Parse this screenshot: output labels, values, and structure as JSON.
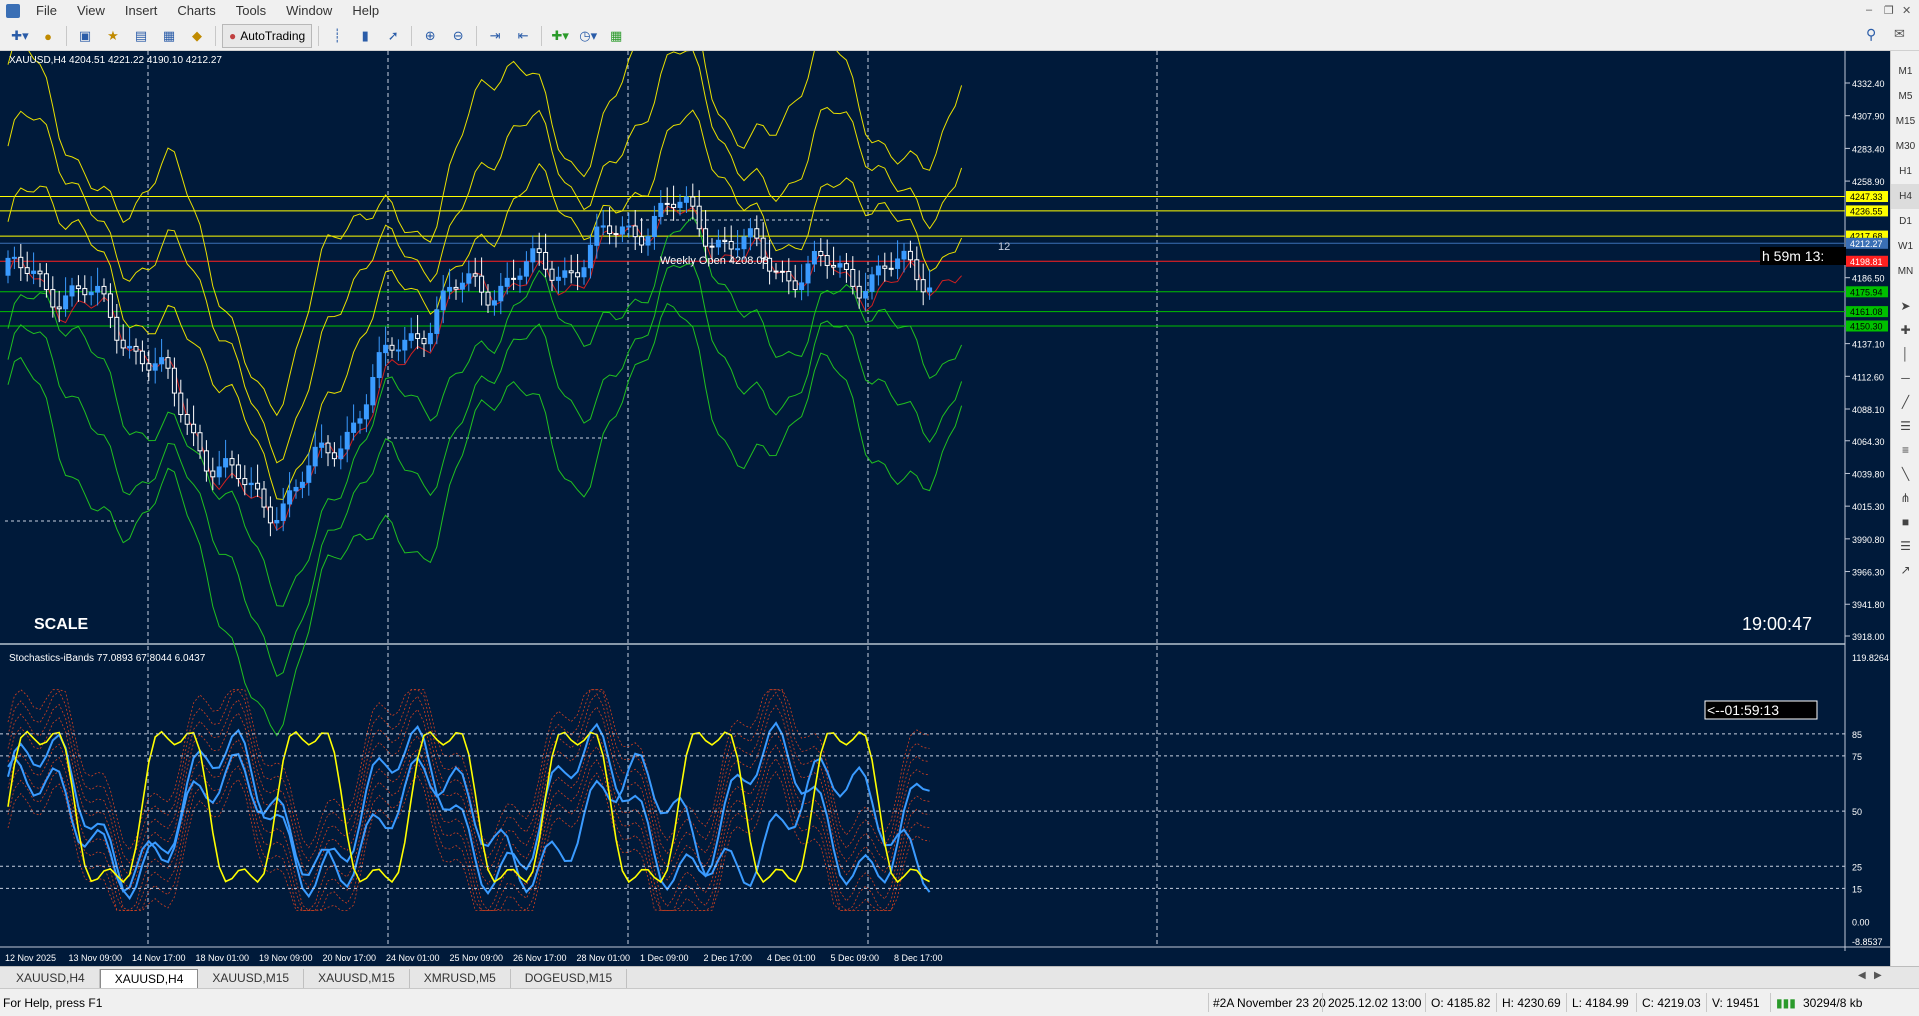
{
  "menu": [
    "File",
    "View",
    "Insert",
    "Charts",
    "Tools",
    "Window",
    "Help"
  ],
  "toolbar": {
    "autotrading_label": "AutoTrading"
  },
  "chart": {
    "main_header": "XAUUSD,H4  4204.51 4221.22 4190.10 4212.27",
    "indicator_header": "Stochastics-iBands 77.0893 67.8044 6.0437",
    "scale_label": "SCALE",
    "clock": "19:00:47",
    "countdown_main": "h 59m 13:",
    "countdown_sub": "<--01:59:13",
    "annotation_12": "12",
    "weekly_label": "Weekly Open 4208.08",
    "price_axis": [
      "4332.40",
      "4307.90",
      "4283.40",
      "4258.90",
      "4186.50",
      "4137.10",
      "4112.60",
      "4088.10",
      "4064.30",
      "4039.80",
      "4015.30",
      "3990.80",
      "3966.30",
      "3941.80",
      "3918.00"
    ],
    "price_tags": [
      {
        "label": "4247.33",
        "color": "#ffff00",
        "text": "#000000"
      },
      {
        "label": "4236.55",
        "color": "#ffff00",
        "text": "#000000"
      },
      {
        "label": "4217.68",
        "color": "#ffff00",
        "text": "#000000"
      },
      {
        "label": "4212.27",
        "color": "#3a6fb5",
        "text": "#ffffff"
      },
      {
        "label": "4198.81",
        "color": "#ff2020",
        "text": "#ffffff"
      },
      {
        "label": "4175.94",
        "color": "#00c000",
        "text": "#000000"
      },
      {
        "label": "4161.08",
        "color": "#00c000",
        "text": "#000000"
      },
      {
        "label": "4150.30",
        "color": "#00c000",
        "text": "#000000"
      }
    ],
    "sub_axis": [
      "119.8264",
      "85",
      "75",
      "50",
      "25",
      "15",
      "0.00",
      "-8.8537"
    ],
    "time_axis": [
      "12 Nov 2025",
      "13 Nov 09:00",
      "14 Nov 17:00",
      "18 Nov 01:00",
      "19 Nov 09:00",
      "20 Nov 17:00",
      "24 Nov 01:00",
      "25 Nov 09:00",
      "26 Nov 17:00",
      "28 Nov 01:00",
      "1 Dec 09:00",
      "2 Dec 17:00",
      "4 Dec 01:00",
      "5 Dec 09:00",
      "8 Dec 17:00"
    ]
  },
  "timeframes": [
    "M1",
    "M5",
    "M15",
    "M30",
    "H1",
    "H4",
    "D1",
    "W1",
    "MN"
  ],
  "active_timeframe": "H4",
  "tabs": [
    "XAUUSD,H4",
    "XAUUSD,H4",
    "XAUUSD,M15",
    "XAUUSD,M15",
    "XMRUSD,M5",
    "DOGEUSD,M15"
  ],
  "active_tab": 1,
  "status": {
    "help": "For Help, press F1",
    "profile": "#2A November 23 20",
    "datetime": "2025.12.02 13:00",
    "open": "O: 4185.82",
    "high": "H: 4230.69",
    "low": "L: 4184.99",
    "close": "C: 4219.03",
    "volume": "V: 19451",
    "traffic": "30294/8 kb"
  }
}
